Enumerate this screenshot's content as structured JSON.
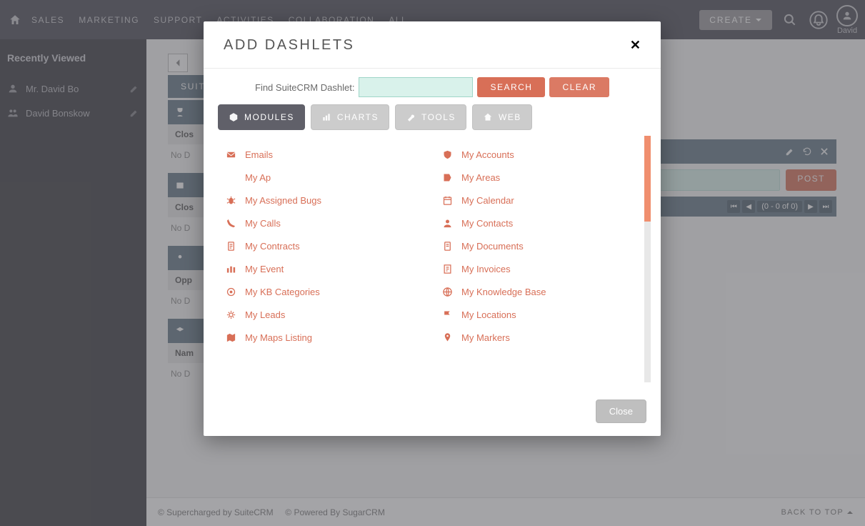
{
  "topbar": {
    "nav": [
      "SALES",
      "MARKETING",
      "SUPPORT",
      "ACTIVITIES",
      "COLLABORATION",
      "ALL"
    ],
    "create": "CREATE",
    "user": "David"
  },
  "sidebar": {
    "title": "Recently Viewed",
    "items": [
      {
        "label": "Mr. David Bo"
      },
      {
        "label": "David Bonskow"
      }
    ]
  },
  "main": {
    "tab": "SUIT",
    "dashlets": [
      {
        "sub": "Clos",
        "nd": "No D"
      },
      {
        "sub": "Clos",
        "nd": "No D"
      },
      {
        "sub": "Opp",
        "nd": "No D"
      },
      {
        "sub": "Nam",
        "nd": "No D"
      }
    ]
  },
  "rightpanel": {
    "post": "POST",
    "pager": "(0 - 0 of 0)"
  },
  "footer": {
    "left1": "© Supercharged by SuiteCRM",
    "left2": "© Powered By SugarCRM",
    "btt": "BACK TO TOP"
  },
  "modal": {
    "title": "ADD DASHLETS",
    "find_label": "Find SuiteCRM Dashlet:",
    "search": "SEARCH",
    "clear": "CLEAR",
    "close": "Close",
    "tabs": [
      {
        "key": "modules",
        "label": "MODULES",
        "active": true
      },
      {
        "key": "charts",
        "label": "CHARTS",
        "active": false
      },
      {
        "key": "tools",
        "label": "TOOLS",
        "active": false
      },
      {
        "key": "web",
        "label": "WEB",
        "active": false
      }
    ],
    "items_left": [
      {
        "icon": "mail",
        "label": "Emails"
      },
      {
        "icon": "blank",
        "label": "My Ap"
      },
      {
        "icon": "bug",
        "label": "My Assigned Bugs"
      },
      {
        "icon": "phone",
        "label": "My Calls"
      },
      {
        "icon": "doc",
        "label": "My Contracts"
      },
      {
        "icon": "event",
        "label": "My Event"
      },
      {
        "icon": "tag",
        "label": "My KB Categories"
      },
      {
        "icon": "leads",
        "label": "My Leads"
      },
      {
        "icon": "map",
        "label": "My Maps Listing"
      }
    ],
    "items_right": [
      {
        "icon": "shield",
        "label": "My Accounts"
      },
      {
        "icon": "area",
        "label": "My Areas"
      },
      {
        "icon": "cal",
        "label": "My Calendar"
      },
      {
        "icon": "person",
        "label": "My Contacts"
      },
      {
        "icon": "docs",
        "label": "My Documents"
      },
      {
        "icon": "invoice",
        "label": "My Invoices"
      },
      {
        "icon": "kb",
        "label": "My Knowledge Base"
      },
      {
        "icon": "flag",
        "label": "My Locations"
      },
      {
        "icon": "marker",
        "label": "My Markers"
      }
    ]
  }
}
